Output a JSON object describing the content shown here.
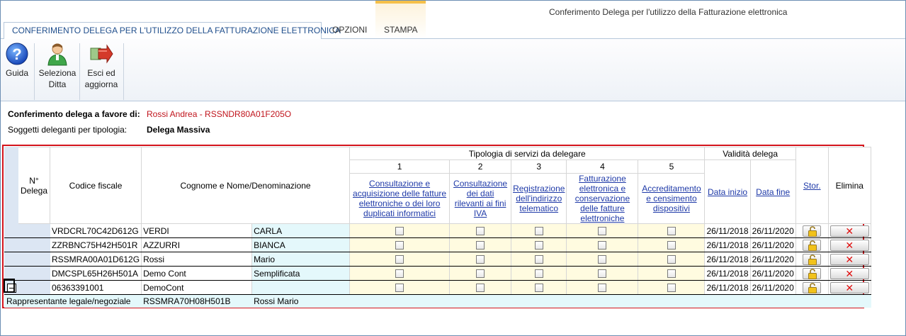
{
  "window": {
    "title": "Conferimento Delega per l'utilizzo della Fatturazione elettronica"
  },
  "tabs": [
    {
      "label": "CONFERIMENTO DELEGA PER L'UTILIZZO DELLA FATTURAZIONE ELETTRONICA",
      "active": true
    },
    {
      "label": "OPZIONI",
      "active": false
    },
    {
      "label": "STAMPA",
      "active": false
    }
  ],
  "ribbon": {
    "guida": {
      "label": "Guida",
      "icon": "help-icon"
    },
    "seleziona_ditta": {
      "line1": "Seleziona",
      "line2": "Ditta",
      "icon": "user-icon"
    },
    "esci": {
      "line1": "Esci ed",
      "line2": "aggiorna",
      "icon": "exit-arrow-icon"
    }
  },
  "info": {
    "conferimento_label": "Conferimento delega a favore di:",
    "conferimento_value": "Rossi Andrea - RSSNDR80A01F205O",
    "soggetti_label": "Soggetti deleganti per tipologia:",
    "soggetti_value": "Delega Massiva"
  },
  "grid": {
    "headers": {
      "n_delega": "N° Delega",
      "codice_fiscale": "Codice fiscale",
      "cognome_nome": "Cognome e Nome/Denominazione",
      "tipologia": "Tipologia di servizi da delegare",
      "validita": "Validità delega",
      "stor": "Stor.",
      "elimina": "Elimina",
      "service_numbers": [
        "1",
        "2",
        "3",
        "4",
        "5"
      ],
      "services": [
        "Consultazione e acquisizione delle fatture elettroniche o dei loro duplicati informatici",
        "Consultazione dei dati rilevanti ai fini IVA",
        "Registrazione dell'indirizzo telematico",
        "Fatturazione elettronica e conservazione delle fatture elettroniche",
        "Accreditamento e censimento dispositivi"
      ],
      "data_inizio": "Data inizio",
      "data_fine": "Data fine"
    },
    "rows": [
      {
        "cf": "VRDCRL70C42D612G",
        "cognome": "VERDI",
        "nome": "CARLA",
        "inizio": "26/11/2018",
        "fine": "26/11/2020",
        "checks": [
          false,
          false,
          false,
          false,
          false
        ]
      },
      {
        "cf": "ZZRBNC75H42H501R",
        "cognome": "AZZURRI",
        "nome": "BIANCA",
        "inizio": "26/11/2018",
        "fine": "26/11/2020",
        "checks": [
          false,
          false,
          false,
          false,
          false
        ]
      },
      {
        "cf": "RSSMRA00A01D612G",
        "cognome": "Rossi",
        "nome": "Mario",
        "inizio": "26/11/2018",
        "fine": "26/11/2020",
        "checks": [
          false,
          false,
          false,
          false,
          false
        ]
      },
      {
        "cf": "DMCSPL65H26H501A",
        "cognome": "Demo Cont",
        "nome": "Semplificata",
        "inizio": "26/11/2018",
        "fine": "26/11/2020",
        "checks": [
          false,
          false,
          false,
          false,
          false
        ]
      },
      {
        "cf": "06363391001",
        "cognome": "DemoCont",
        "nome": "",
        "inizio": "26/11/2018",
        "fine": "26/11/2020",
        "checks": [
          false,
          false,
          false,
          false,
          false
        ]
      }
    ],
    "representative": {
      "label": "Rappresentante legale/negoziale",
      "cf": "RSSMRA70H08H501B",
      "name": "Rossi Mario"
    },
    "icons": {
      "stor": "lock-icon",
      "elimina": "delete-x-icon"
    }
  },
  "colors": {
    "accent": "#1f4e8c",
    "highlight": "#c0141c",
    "frame": "#d4141c",
    "cyan_cell": "#e4f8fb",
    "yellow_cell": "#fffbe0"
  }
}
